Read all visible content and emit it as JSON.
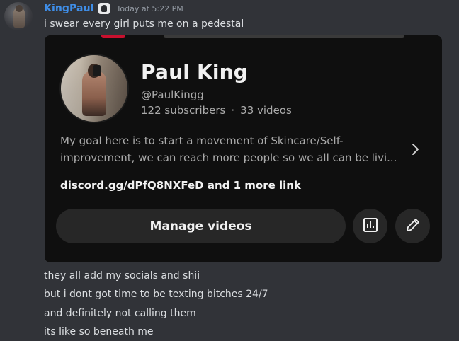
{
  "message": {
    "username": "KingPaul",
    "timestamp": "Today at 5:22 PM",
    "first_line": "i swear every girl puts me on a pedestal",
    "follow_lines": [
      "they all add my socials and shii",
      "but i dont got time to be texting bitches 24/7",
      "and definitely not calling them",
      "its like so beneath me"
    ]
  },
  "embed": {
    "channel_name": "Paul King",
    "handle": "@PaulKingg",
    "subscribers": "122 subscribers",
    "videos": "33 videos",
    "description_lines": [
      "My goal here is to start a movement of Skincare/Self-",
      "improvement, we can reach more people so we all can be livi..."
    ],
    "links": "discord.gg/dPfQ8NXFeD and 1 more link",
    "manage_label": "Manage videos"
  },
  "icons": {
    "avatar": "user-avatar",
    "badge": "server-tag-icon",
    "chevron": "chevron-right-icon",
    "analytics": "analytics-icon",
    "edit": "pencil-icon"
  },
  "colors": {
    "background": "#313338",
    "username": "#3f8ee8",
    "card": "#0f0f0f",
    "button": "#272727",
    "youtube_red": "#c8102e"
  }
}
